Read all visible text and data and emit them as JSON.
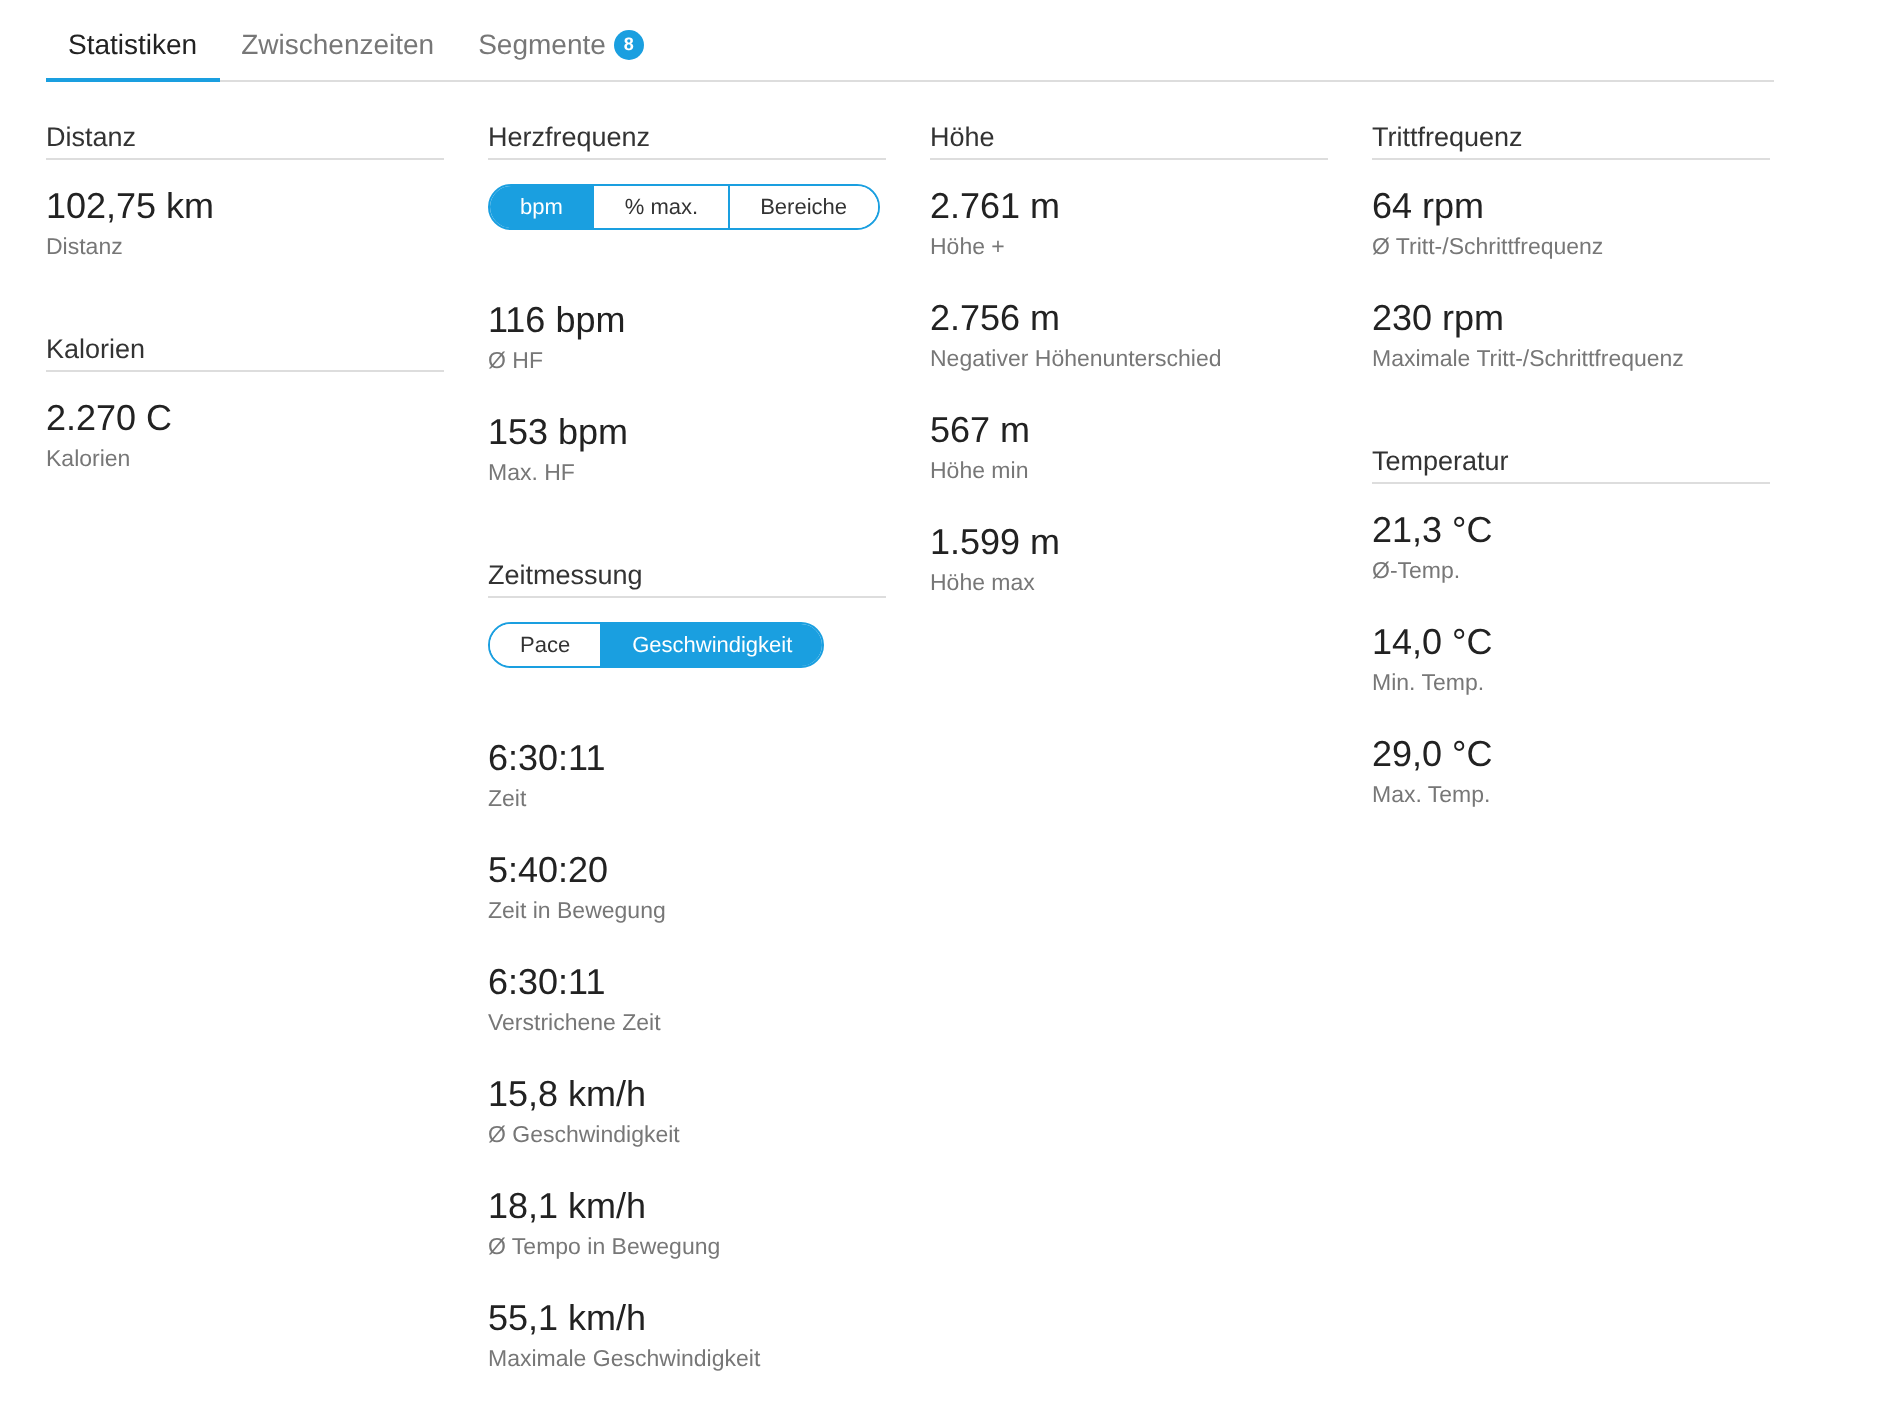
{
  "tabs": [
    {
      "label": "Statistiken",
      "selected": true
    },
    {
      "label": "Zwischenzeiten",
      "selected": false
    },
    {
      "label": "Segmente",
      "selected": false,
      "badge": "8"
    }
  ],
  "columns": [
    {
      "sections": [
        {
          "title": "Distanz",
          "stats": [
            {
              "value": "102,75 km",
              "label": "Distanz"
            }
          ]
        },
        {
          "title": "Kalorien",
          "stats": [
            {
              "value": "2.270 C",
              "label": "Kalorien"
            }
          ]
        }
      ]
    },
    {
      "sections": [
        {
          "title": "Herzfrequenz",
          "toggle": [
            {
              "label": "bpm",
              "selected": true
            },
            {
              "label": "% max.",
              "selected": false
            },
            {
              "label": "Bereiche",
              "selected": false
            }
          ],
          "stats": [
            {
              "value": "116 bpm",
              "label": "Ø HF"
            },
            {
              "value": "153 bpm",
              "label": "Max. HF"
            }
          ]
        },
        {
          "title": "Zeitmessung",
          "toggle": [
            {
              "label": "Pace",
              "selected": false
            },
            {
              "label": "Geschwindigkeit",
              "selected": true
            }
          ],
          "stats": [
            {
              "value": "6:30:11",
              "label": "Zeit"
            },
            {
              "value": "5:40:20",
              "label": "Zeit in Bewegung"
            },
            {
              "value": "6:30:11",
              "label": "Verstrichene Zeit"
            },
            {
              "value": "15,8 km/h",
              "label": "Ø Geschwindigkeit"
            },
            {
              "value": "18,1 km/h",
              "label": "Ø Tempo in Bewegung"
            },
            {
              "value": "55,1 km/h",
              "label": "Maximale Geschwindigkeit"
            }
          ]
        }
      ]
    },
    {
      "sections": [
        {
          "title": "Höhe",
          "stats": [
            {
              "value": "2.761 m",
              "label": "Höhe +"
            },
            {
              "value": "2.756 m",
              "label": "Negativer Höhenunterschied"
            },
            {
              "value": "567 m",
              "label": "Höhe min"
            },
            {
              "value": "1.599 m",
              "label": "Höhe max"
            }
          ]
        }
      ]
    },
    {
      "sections": [
        {
          "title": "Trittfrequenz",
          "stats": [
            {
              "value": "64 rpm",
              "label": "Ø Tritt-/Schrittfrequenz"
            },
            {
              "value": "230 rpm",
              "label": "Maximale Tritt-/Schrittfrequenz"
            }
          ]
        },
        {
          "title": "Temperatur",
          "stats": [
            {
              "value": "21,3 °C",
              "label": "Ø-Temp."
            },
            {
              "value": "14,0 °C",
              "label": "Min. Temp."
            },
            {
              "value": "29,0 °C",
              "label": "Max. Temp."
            }
          ]
        }
      ]
    }
  ]
}
